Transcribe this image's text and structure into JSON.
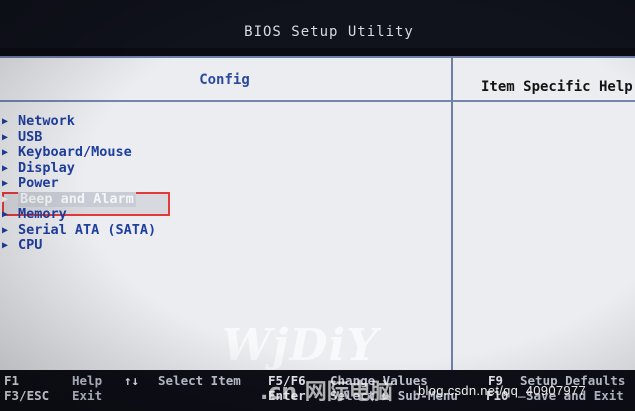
{
  "app": {
    "title": "BIOS Setup Utility"
  },
  "tabs": {
    "active": "Config"
  },
  "right_panel": {
    "header": "Item Specific Help"
  },
  "menu": {
    "items": [
      {
        "label": "Network"
      },
      {
        "label": "USB"
      },
      {
        "label": "Keyboard/Mouse"
      },
      {
        "label": "Display"
      },
      {
        "label": "Power"
      },
      {
        "label": "Beep and Alarm",
        "selected": true
      },
      {
        "label": "Memory"
      },
      {
        "label": "Serial ATA (SATA)"
      },
      {
        "label": "CPU"
      }
    ]
  },
  "footer": {
    "row1": [
      {
        "key": "F1",
        "desc": "Help"
      },
      {
        "key": "↑↓",
        "desc": "Select Item"
      },
      {
        "key": "F5/F6",
        "desc": "Change Values"
      },
      {
        "key": "F9",
        "desc": "Setup Defaults"
      }
    ],
    "row2": [
      {
        "key": "F3/ESC",
        "desc": "Exit"
      },
      {
        "key": "Enter",
        "desc": "Select ▶ Sub-Menu"
      },
      {
        "key": "F10",
        "desc": "Save and Exit"
      }
    ]
  },
  "watermark": {
    "logo": "WjDiY",
    "sub": ".cn 网际电脑",
    "url": "blog.csdn.net/qq_40907977"
  },
  "colors": {
    "panel_bg": "#ecedf1",
    "menu_text": "#1f3f9f",
    "highlight": "#e23a3a",
    "screen_bg": "#0b0b14"
  }
}
